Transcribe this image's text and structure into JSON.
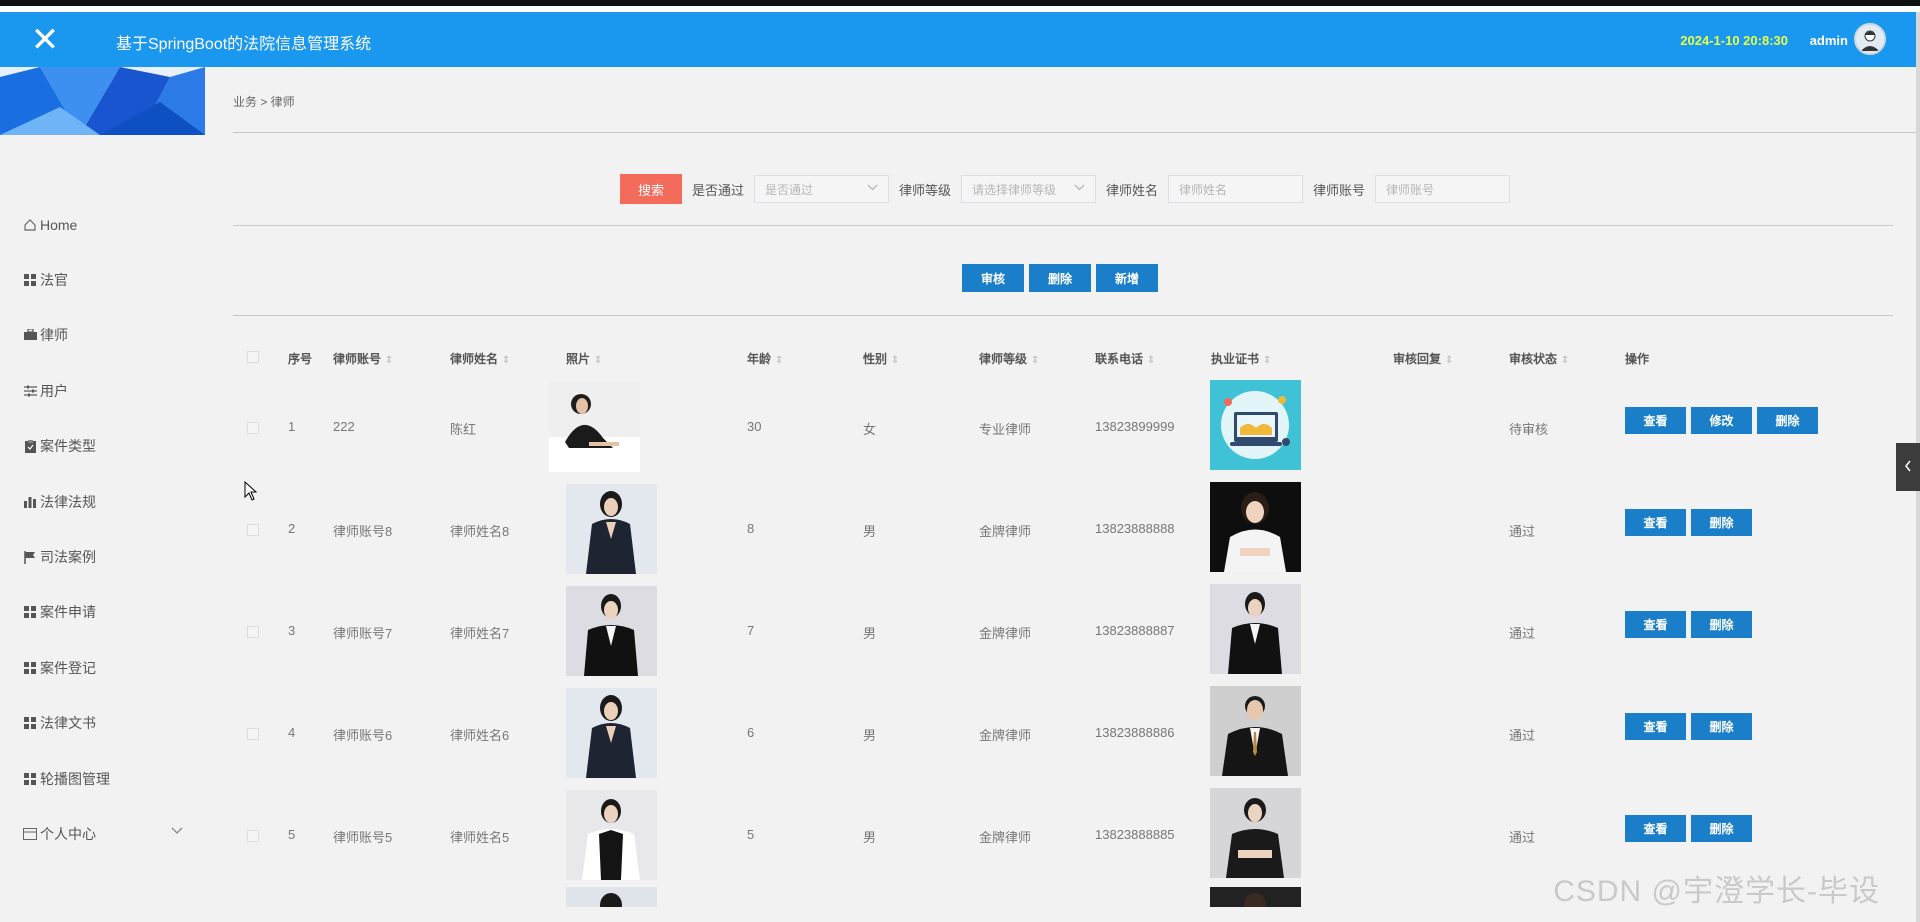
{
  "header": {
    "close_icon": "close-icon",
    "title": "基于SpringBoot的法院信息管理系统",
    "datetime": "2024-1-10 20:8:30",
    "username": "admin",
    "avatar_icon": "avatar-icon"
  },
  "colors": {
    "navbar": "#1a97ee",
    "search_button": "#f26b5b",
    "action_button": "#1a7fc8",
    "datetime": "#e6ff4a"
  },
  "sidebar": {
    "items": [
      {
        "label": "Home",
        "icon": "home-icon"
      },
      {
        "label": "法官",
        "icon": "grid-icon"
      },
      {
        "label": "律师",
        "icon": "briefcase-icon"
      },
      {
        "label": "用户",
        "icon": "sliders-icon"
      },
      {
        "label": "案件类型",
        "icon": "clipboard-icon"
      },
      {
        "label": "法律法规",
        "icon": "bar-chart-icon"
      },
      {
        "label": "司法案例",
        "icon": "flag-icon"
      },
      {
        "label": "案件申请",
        "icon": "grid-icon"
      },
      {
        "label": "案件登记",
        "icon": "grid-icon"
      },
      {
        "label": "法律文书",
        "icon": "grid-icon"
      },
      {
        "label": "轮播图管理",
        "icon": "grid-icon"
      },
      {
        "label": "个人中心",
        "icon": "card-icon",
        "expandable": true
      }
    ]
  },
  "breadcrumb": {
    "text": "业务 > 律师"
  },
  "search": {
    "button_label": "搜索",
    "fields": [
      {
        "label": "是否通过",
        "placeholder": "是否通过",
        "type": "select"
      },
      {
        "label": "律师等级",
        "placeholder": "请选择律师等级",
        "type": "select"
      },
      {
        "label": "律师姓名",
        "placeholder": "律师姓名",
        "type": "input"
      },
      {
        "label": "律师账号",
        "placeholder": "律师账号",
        "type": "input"
      }
    ]
  },
  "actions": {
    "review": "审核",
    "delete": "删除",
    "add": "新增"
  },
  "table": {
    "columns": [
      "序号",
      "律师账号",
      "律师姓名",
      "照片",
      "年龄",
      "性别",
      "律师等级",
      "联系电话",
      "执业证书",
      "审核回复",
      "审核状态",
      "操作"
    ],
    "rows": [
      {
        "no": "1",
        "account": "222",
        "name": "陈红",
        "age": "30",
        "gender": "女",
        "level": "专业律师",
        "phone": "13823899999",
        "reply": "",
        "status": "待审核",
        "ops": [
          "查看",
          "修改",
          "删除"
        ]
      },
      {
        "no": "2",
        "account": "律师账号8",
        "name": "律师姓名8",
        "age": "8",
        "gender": "男",
        "level": "金牌律师",
        "phone": "13823888888",
        "reply": "",
        "status": "通过",
        "ops": [
          "查看",
          "删除"
        ]
      },
      {
        "no": "3",
        "account": "律师账号7",
        "name": "律师姓名7",
        "age": "7",
        "gender": "男",
        "level": "金牌律师",
        "phone": "13823888887",
        "reply": "",
        "status": "通过",
        "ops": [
          "查看",
          "删除"
        ]
      },
      {
        "no": "4",
        "account": "律师账号6",
        "name": "律师姓名6",
        "age": "6",
        "gender": "男",
        "level": "金牌律师",
        "phone": "13823888886",
        "reply": "",
        "status": "通过",
        "ops": [
          "查看",
          "删除"
        ]
      },
      {
        "no": "5",
        "account": "律师账号5",
        "name": "律师姓名5",
        "age": "5",
        "gender": "男",
        "level": "金牌律师",
        "phone": "13823888885",
        "reply": "",
        "status": "通过",
        "ops": [
          "查看",
          "删除"
        ]
      }
    ]
  },
  "watermark": "CSDN @宇澄学长-毕设"
}
